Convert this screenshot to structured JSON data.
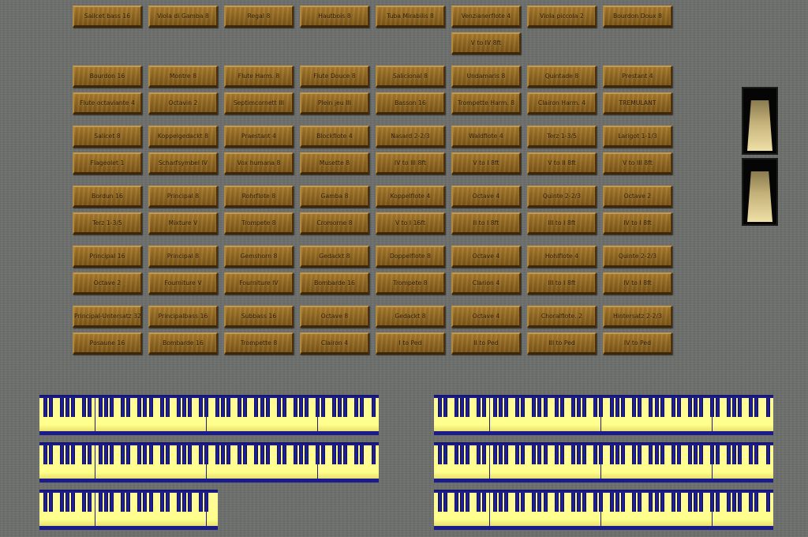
{
  "stop_rows": [
    {
      "label": "Sailcet bass 16",
      "col": 0,
      "row": 0
    },
    {
      "label": "Viola di Gamba 8",
      "col": 1,
      "row": 0
    },
    {
      "label": "Regal 8",
      "col": 2,
      "row": 0
    },
    {
      "label": "Hautbois 8",
      "col": 3,
      "row": 0
    },
    {
      "label": "Tuba Mirabilis 8",
      "col": 4,
      "row": 0
    },
    {
      "label": "Venzianerflote 4",
      "col": 5,
      "row": 0
    },
    {
      "label": "Viola piccola 2",
      "col": 6,
      "row": 0
    },
    {
      "label": "Bourdon Doux 8",
      "col": 7,
      "row": 0
    },
    {
      "label": "V to IV 8ft",
      "col": 5,
      "row": 1
    },
    {
      "label": "Bourdon 16",
      "col": 0,
      "row": 2
    },
    {
      "label": "Montre 8",
      "col": 1,
      "row": 2
    },
    {
      "label": "Flute Harm. 8",
      "col": 2,
      "row": 2
    },
    {
      "label": "Flute Douce 8",
      "col": 3,
      "row": 2
    },
    {
      "label": "Salicional 8",
      "col": 4,
      "row": 2
    },
    {
      "label": "Undamaris 8",
      "col": 5,
      "row": 2
    },
    {
      "label": "Quintade 8",
      "col": 6,
      "row": 2
    },
    {
      "label": "Prestant 4",
      "col": 7,
      "row": 2
    },
    {
      "label": "Flute octaviante 4",
      "col": 0,
      "row": 3
    },
    {
      "label": "Octavin 2",
      "col": 1,
      "row": 3
    },
    {
      "label": "Septimcornett III",
      "col": 2,
      "row": 3
    },
    {
      "label": "Plein jeu III",
      "col": 3,
      "row": 3
    },
    {
      "label": "Basson 16",
      "col": 4,
      "row": 3
    },
    {
      "label": "Trompette Harm. 8",
      "col": 5,
      "row": 3
    },
    {
      "label": "Clairon Harm. 4",
      "col": 6,
      "row": 3
    },
    {
      "label": "TREMULANT",
      "col": 7,
      "row": 3
    },
    {
      "label": "Salicet 8",
      "col": 0,
      "row": 4
    },
    {
      "label": "Koppelgedackt 8",
      "col": 1,
      "row": 4
    },
    {
      "label": "Praestant 4",
      "col": 2,
      "row": 4
    },
    {
      "label": "Blockflote 4",
      "col": 3,
      "row": 4
    },
    {
      "label": "Nasard 2-2/3",
      "col": 4,
      "row": 4
    },
    {
      "label": "Waldflote 4",
      "col": 5,
      "row": 4
    },
    {
      "label": "Terz 1-3/5",
      "col": 6,
      "row": 4
    },
    {
      "label": "Larigot 1-1/3",
      "col": 7,
      "row": 4
    },
    {
      "label": "Flageolet 1",
      "col": 0,
      "row": 5
    },
    {
      "label": "Scharfsymbel IV",
      "col": 1,
      "row": 5
    },
    {
      "label": "Vox humana 8",
      "col": 2,
      "row": 5
    },
    {
      "label": "Musette 8",
      "col": 3,
      "row": 5
    },
    {
      "label": "IV to III 8ft",
      "col": 4,
      "row": 5
    },
    {
      "label": "V to I 8ft",
      "col": 5,
      "row": 5
    },
    {
      "label": "V to II 8ft",
      "col": 6,
      "row": 5
    },
    {
      "label": "V to III 8ft",
      "col": 7,
      "row": 5
    },
    {
      "label": "Bordun 16",
      "col": 0,
      "row": 6
    },
    {
      "label": "Principal 8",
      "col": 1,
      "row": 6
    },
    {
      "label": "Rohrflote 8",
      "col": 2,
      "row": 6
    },
    {
      "label": "Gamba 8",
      "col": 3,
      "row": 6
    },
    {
      "label": "Koppelflote 4",
      "col": 4,
      "row": 6
    },
    {
      "label": "Octave 4",
      "col": 5,
      "row": 6
    },
    {
      "label": "Quinte 2-2/3",
      "col": 6,
      "row": 6
    },
    {
      "label": "Octave 2",
      "col": 7,
      "row": 6
    },
    {
      "label": "Terz 1-3/5",
      "col": 0,
      "row": 7
    },
    {
      "label": "Mixture V",
      "col": 1,
      "row": 7
    },
    {
      "label": "Trompete 8",
      "col": 2,
      "row": 7
    },
    {
      "label": "Cromorne 8",
      "col": 3,
      "row": 7
    },
    {
      "label": "V to I 16ft",
      "col": 4,
      "row": 7
    },
    {
      "label": "II to I 8ft",
      "col": 5,
      "row": 7
    },
    {
      "label": "III to I 8ft",
      "col": 6,
      "row": 7
    },
    {
      "label": "IV to I 8ft",
      "col": 7,
      "row": 7
    },
    {
      "label": "Principal 16",
      "col": 0,
      "row": 8
    },
    {
      "label": "Principal 8",
      "col": 1,
      "row": 8
    },
    {
      "label": "Gemshorn 8",
      "col": 2,
      "row": 8
    },
    {
      "label": "Gedackt 8",
      "col": 3,
      "row": 8
    },
    {
      "label": "Doppelflote 8",
      "col": 4,
      "row": 8
    },
    {
      "label": "Octave 4",
      "col": 5,
      "row": 8
    },
    {
      "label": "Hohlflote 4",
      "col": 6,
      "row": 8
    },
    {
      "label": "Quinte 2-2/3",
      "col": 7,
      "row": 8
    },
    {
      "label": "Octave 2",
      "col": 0,
      "row": 9
    },
    {
      "label": "Fourniture V",
      "col": 1,
      "row": 9
    },
    {
      "label": "Fourniture IV",
      "col": 2,
      "row": 9
    },
    {
      "label": "Bombarde 16",
      "col": 3,
      "row": 9
    },
    {
      "label": "Trompete 8",
      "col": 4,
      "row": 9
    },
    {
      "label": "Clarion 4",
      "col": 5,
      "row": 9
    },
    {
      "label": "III to I 8ft",
      "col": 6,
      "row": 9
    },
    {
      "label": "IV to I 8ft",
      "col": 7,
      "row": 9
    },
    {
      "label": "Principal-Untersatz 32",
      "col": 0,
      "row": 10
    },
    {
      "label": "Principalbass 16",
      "col": 1,
      "row": 10
    },
    {
      "label": "Subbass 16",
      "col": 2,
      "row": 10
    },
    {
      "label": "Octave 8",
      "col": 3,
      "row": 10
    },
    {
      "label": "Gedackt 8",
      "col": 4,
      "row": 10
    },
    {
      "label": "Octave 4",
      "col": 5,
      "row": 10
    },
    {
      "label": "Choralflote. 2",
      "col": 6,
      "row": 10
    },
    {
      "label": "Hintersatz 2-2/3",
      "col": 7,
      "row": 10
    },
    {
      "label": "Posaune 16",
      "col": 0,
      "row": 11
    },
    {
      "label": "Bombarde 16",
      "col": 1,
      "row": 11
    },
    {
      "label": "Trompette 8",
      "col": 2,
      "row": 11
    },
    {
      "label": "Clairon 4",
      "col": 3,
      "row": 11
    },
    {
      "label": "I to Ped",
      "col": 4,
      "row": 11
    },
    {
      "label": "II to Ped",
      "col": 5,
      "row": 11
    },
    {
      "label": "III to Ped",
      "col": 6,
      "row": 11
    },
    {
      "label": "IV to Ped",
      "col": 7,
      "row": 11
    }
  ],
  "swell_pedals": [
    {
      "name": "swell-pedal-1"
    },
    {
      "name": "swell-pedal-2"
    }
  ],
  "keyboards": [
    {
      "name": "manual-keyboard-1",
      "white_keys": 61
    },
    {
      "name": "manual-keyboard-2",
      "white_keys": 61
    },
    {
      "name": "manual-keyboard-3",
      "white_keys": 61
    },
    {
      "name": "manual-keyboard-4",
      "white_keys": 61
    },
    {
      "name": "pedal-keyboard",
      "white_keys": 32
    },
    {
      "name": "manual-keyboard-5",
      "white_keys": 61
    }
  ],
  "colors": {
    "background": "#6c6e6b",
    "stop_wood": "#8a6420",
    "key_white": "#ffff8c",
    "key_black": "#1e1e96"
  }
}
